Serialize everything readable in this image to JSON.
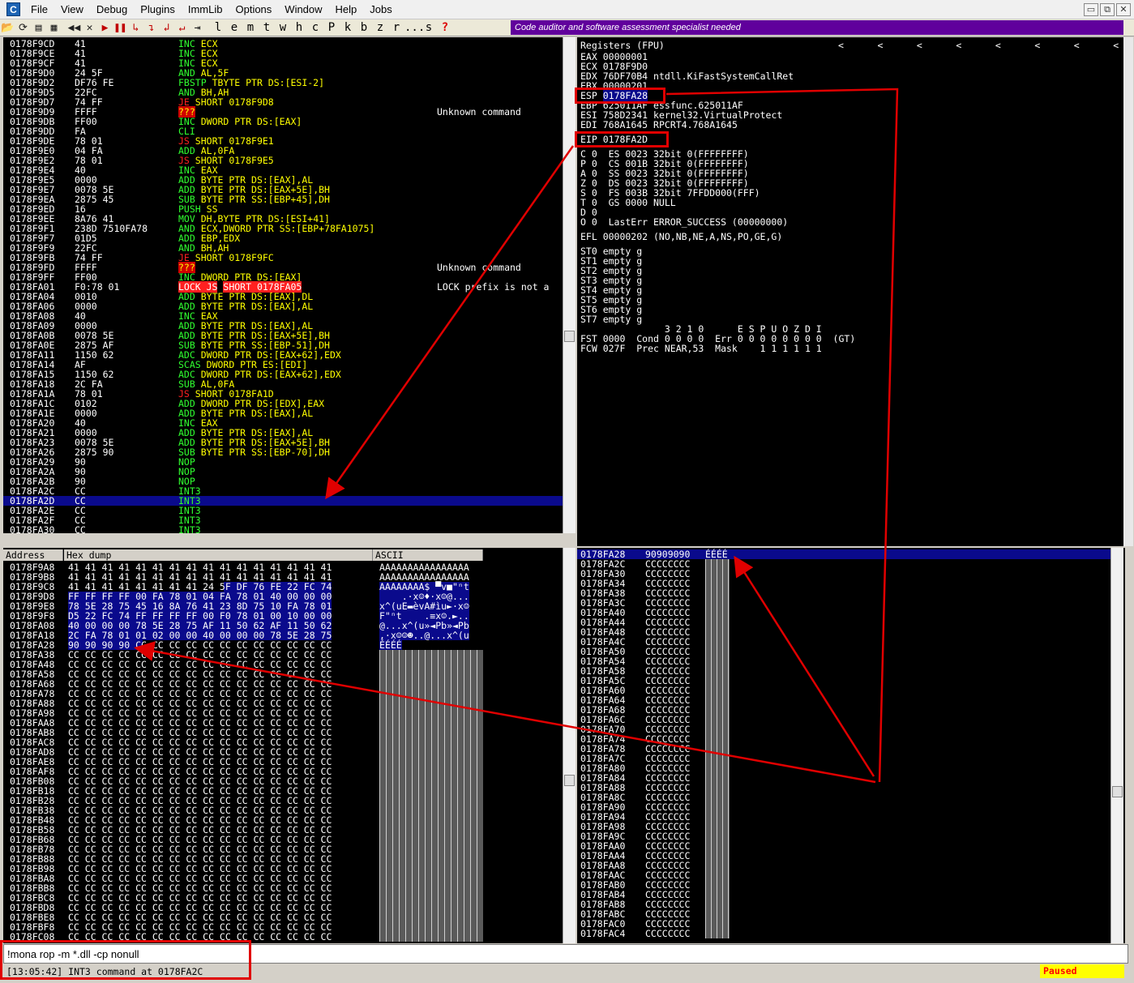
{
  "app": {
    "icon_letter": "C"
  },
  "menu": [
    "File",
    "View",
    "Debug",
    "Plugins",
    "ImmLib",
    "Options",
    "Window",
    "Help",
    "Jobs"
  ],
  "window_buttons": [
    "▭",
    "⧉",
    "✕"
  ],
  "toolbar": {
    "letters": [
      "l",
      "e",
      "m",
      "t",
      "w",
      "h",
      "c",
      "P",
      "k",
      "b",
      "z",
      "r",
      "...",
      "s"
    ],
    "help": "?",
    "banner": "Code auditor and software assessment specialist needed"
  },
  "cpu": {
    "rows": [
      {
        "addr": "0178F9CD",
        "hex": "41",
        "mn": "INC",
        "op": "ECX",
        "cm": ""
      },
      {
        "addr": "0178F9CE",
        "hex": "41",
        "mn": "INC",
        "op": "ECX",
        "cm": ""
      },
      {
        "addr": "0178F9CF",
        "hex": "41",
        "mn": "INC",
        "op": "ECX",
        "cm": ""
      },
      {
        "addr": "0178F9D0",
        "hex": "24 5F",
        "mn": "AND",
        "op": "AL,5F",
        "cm": ""
      },
      {
        "addr": "0178F9D2",
        "hex": "DF76 FE",
        "mn": "FBSTP",
        "op": "TBYTE PTR DS:[ESI-2]",
        "cm": ""
      },
      {
        "addr": "0178F9D5",
        "hex": "22FC",
        "mn": "AND",
        "op": "BH,AH",
        "cm": ""
      },
      {
        "addr": "0178F9D7",
        "hex": "74 FF",
        "mn": "JE",
        "op": "SHORT 0178F9D8",
        "cm": ""
      },
      {
        "addr": "0178F9D9",
        "hex": "FFFF",
        "mn": "???",
        "op": "",
        "cm": "Unknown command"
      },
      {
        "addr": "0178F9DB",
        "hex": "FF00",
        "mn": "INC",
        "op": "DWORD PTR DS:[EAX]",
        "cm": ""
      },
      {
        "addr": "0178F9DD",
        "hex": "FA",
        "mn": "CLI",
        "op": "",
        "cm": ""
      },
      {
        "addr": "0178F9DE",
        "hex": "78 01",
        "mn": "JS",
        "op": "SHORT 0178F9E1",
        "cm": ""
      },
      {
        "addr": "0178F9E0",
        "hex": "04 FA",
        "mn": "ADD",
        "op": "AL,0FA",
        "cm": ""
      },
      {
        "addr": "0178F9E2",
        "hex": "78 01",
        "mn": "JS",
        "op": "SHORT 0178F9E5",
        "cm": ""
      },
      {
        "addr": "0178F9E4",
        "hex": "40",
        "mn": "INC",
        "op": "EAX",
        "cm": ""
      },
      {
        "addr": "0178F9E5",
        "hex": "0000",
        "mn": "ADD",
        "op": "BYTE PTR DS:[EAX],AL",
        "cm": ""
      },
      {
        "addr": "0178F9E7",
        "hex": "0078 5E",
        "mn": "ADD",
        "op": "BYTE PTR DS:[EAX+5E],BH",
        "cm": ""
      },
      {
        "addr": "0178F9EA",
        "hex": "2875 45",
        "mn": "SUB",
        "op": "BYTE PTR SS:[EBP+45],DH",
        "cm": ""
      },
      {
        "addr": "0178F9ED",
        "hex": "16",
        "mn": "PUSH",
        "op": "SS",
        "cm": ""
      },
      {
        "addr": "0178F9EE",
        "hex": "8A76 41",
        "mn": "MOV",
        "op": "DH,BYTE PTR DS:[ESI+41]",
        "cm": ""
      },
      {
        "addr": "0178F9F1",
        "hex": "238D 7510FA78",
        "mn": "AND",
        "op": "ECX,DWORD PTR SS:[EBP+78FA1075]",
        "cm": ""
      },
      {
        "addr": "0178F9F7",
        "hex": "01D5",
        "mn": "ADD",
        "op": "EBP,EDX",
        "cm": ""
      },
      {
        "addr": "0178F9F9",
        "hex": "22FC",
        "mn": "AND",
        "op": "BH,AH",
        "cm": ""
      },
      {
        "addr": "0178F9FB",
        "hex": "74 FF",
        "mn": "JE",
        "op": "SHORT 0178F9FC",
        "cm": ""
      },
      {
        "addr": "0178F9FD",
        "hex": "FFFF",
        "mn": "???",
        "op": "",
        "cm": "Unknown command"
      },
      {
        "addr": "0178F9FF",
        "hex": "FF00",
        "mn": "INC",
        "op": "DWORD PTR DS:[EAX]",
        "cm": ""
      },
      {
        "addr": "0178FA01",
        "hex": "F0:78 01",
        "mn": "LOCK JS",
        "op": "SHORT 0178FA05",
        "cm": "LOCK prefix is not a"
      },
      {
        "addr": "0178FA04",
        "hex": "0010",
        "mn": "ADD",
        "op": "BYTE PTR DS:[EAX],DL",
        "cm": ""
      },
      {
        "addr": "0178FA06",
        "hex": "0000",
        "mn": "ADD",
        "op": "BYTE PTR DS:[EAX],AL",
        "cm": ""
      },
      {
        "addr": "0178FA08",
        "hex": "40",
        "mn": "INC",
        "op": "EAX",
        "cm": ""
      },
      {
        "addr": "0178FA09",
        "hex": "0000",
        "mn": "ADD",
        "op": "BYTE PTR DS:[EAX],AL",
        "cm": ""
      },
      {
        "addr": "0178FA0B",
        "hex": "0078 5E",
        "mn": "ADD",
        "op": "BYTE PTR DS:[EAX+5E],BH",
        "cm": ""
      },
      {
        "addr": "0178FA0E",
        "hex": "2875 AF",
        "mn": "SUB",
        "op": "BYTE PTR SS:[EBP-51],DH",
        "cm": ""
      },
      {
        "addr": "0178FA11",
        "hex": "1150 62",
        "mn": "ADC",
        "op": "DWORD PTR DS:[EAX+62],EDX",
        "cm": ""
      },
      {
        "addr": "0178FA14",
        "hex": "AF",
        "mn": "SCAS",
        "op": "DWORD PTR ES:[EDI]",
        "cm": ""
      },
      {
        "addr": "0178FA15",
        "hex": "1150 62",
        "mn": "ADC",
        "op": "DWORD PTR DS:[EAX+62],EDX",
        "cm": ""
      },
      {
        "addr": "0178FA18",
        "hex": "2C FA",
        "mn": "SUB",
        "op": "AL,0FA",
        "cm": ""
      },
      {
        "addr": "0178FA1A",
        "hex": "78 01",
        "mn": "JS",
        "op": "SHORT 0178FA1D",
        "cm": ""
      },
      {
        "addr": "0178FA1C",
        "hex": "0102",
        "mn": "ADD",
        "op": "DWORD PTR DS:[EDX],EAX",
        "cm": ""
      },
      {
        "addr": "0178FA1E",
        "hex": "0000",
        "mn": "ADD",
        "op": "BYTE PTR DS:[EAX],AL",
        "cm": ""
      },
      {
        "addr": "0178FA20",
        "hex": "40",
        "mn": "INC",
        "op": "EAX",
        "cm": ""
      },
      {
        "addr": "0178FA21",
        "hex": "0000",
        "mn": "ADD",
        "op": "BYTE PTR DS:[EAX],AL",
        "cm": ""
      },
      {
        "addr": "0178FA23",
        "hex": "0078 5E",
        "mn": "ADD",
        "op": "BYTE PTR DS:[EAX+5E],BH",
        "cm": ""
      },
      {
        "addr": "0178FA26",
        "hex": "2875 90",
        "mn": "SUB",
        "op": "BYTE PTR SS:[EBP-70],DH",
        "cm": ""
      },
      {
        "addr": "0178FA29",
        "hex": "90",
        "mn": "NOP",
        "op": "",
        "cm": ""
      },
      {
        "addr": "0178FA2A",
        "hex": "90",
        "mn": "NOP",
        "op": "",
        "cm": ""
      },
      {
        "addr": "0178FA2B",
        "hex": "90",
        "mn": "NOP",
        "op": "",
        "cm": ""
      },
      {
        "addr": "0178FA2C",
        "hex": "CC",
        "mn": "INT3",
        "op": "",
        "cm": ""
      },
      {
        "addr": "0178FA2D",
        "hex": "CC",
        "mn": "INT3",
        "op": "",
        "cm": ""
      },
      {
        "addr": "0178FA2E",
        "hex": "CC",
        "mn": "INT3",
        "op": "",
        "cm": ""
      },
      {
        "addr": "0178FA2F",
        "hex": "CC",
        "mn": "INT3",
        "op": "",
        "cm": ""
      },
      {
        "addr": "0178FA30",
        "hex": "CC",
        "mn": "INT3",
        "op": "",
        "cm": ""
      }
    ]
  },
  "registers": {
    "title": "Registers (FPU)",
    "arrows": "<      <      <      <      <      <      <      <",
    "gp": [
      {
        "name": "EAX",
        "val": "00000001",
        "info": ""
      },
      {
        "name": "ECX",
        "val": "0178F9D0",
        "info": ""
      },
      {
        "name": "EDX",
        "val": "76DF70B4",
        "info": "ntdll.KiFastSystemCallRet"
      },
      {
        "name": "EBX",
        "val": "00000201",
        "info": ""
      },
      {
        "name": "ESP",
        "val": "0178FA28",
        "info": ""
      },
      {
        "name": "EBP",
        "val": "625011AF",
        "info": "essfunc.625011AF"
      },
      {
        "name": "ESI",
        "val": "758D2341",
        "info": "kernel32.VirtualProtect"
      },
      {
        "name": "EDI",
        "val": "768A1645",
        "info": "RPCRT4.768A1645"
      }
    ],
    "eip": {
      "name": "EIP",
      "val": "0178FA2D"
    },
    "flags": [
      "C 0  ES 0023 32bit 0(FFFFFFFF)",
      "P 0  CS 001B 32bit 0(FFFFFFFF)",
      "A 0  SS 0023 32bit 0(FFFFFFFF)",
      "Z 0  DS 0023 32bit 0(FFFFFFFF)",
      "S 0  FS 003B 32bit 7FFDD000(FFF)",
      "T 0  GS 0000 NULL",
      "D 0",
      "O 0  LastErr ERROR_SUCCESS (00000000)"
    ],
    "efl": "EFL 00000202 (NO,NB,NE,A,NS,PO,GE,G)",
    "fpu": [
      "ST0 empty g",
      "ST1 empty g",
      "ST2 empty g",
      "ST3 empty g",
      "ST4 empty g",
      "ST5 empty g",
      "ST6 empty g",
      "ST7 empty g"
    ],
    "fpu_hdr": "               3 2 1 0      E S P U O Z D I",
    "fst": "FST 0000  Cond 0 0 0 0  Err 0 0 0 0 0 0 0 0  (GT)",
    "fcw": "FCW 027F  Prec NEAR,53  Mask    1 1 1 1 1 1"
  },
  "dump": {
    "headers": [
      "Address",
      "Hex dump",
      "ASCII"
    ],
    "rows": [
      {
        "addr": "0178F9A8",
        "hex": "41 41 41 41 41 41 41 41 41 41 41 41 41 41 41 41",
        "asc": "AAAAAAAAAAAAAAAA",
        "hs": -1
      },
      {
        "addr": "0178F9B8",
        "hex": "41 41 41 41 41 41 41 41 41 41 41 41 41 41 41 41",
        "asc": "AAAAAAAAAAAAAAAA",
        "hs": -1
      },
      {
        "addr": "0178F9C8",
        "hex": "41 41 41 41 41 41 41 41 24 5F DF 76 FE 22 FC 74",
        "asc": "AAAAAAAA$_▀v■\"ⁿt",
        "hs": 8
      },
      {
        "addr": "0178F9D8",
        "hex": "FF FF FF FF 00 FA 78 01 04 FA 78 01 40 00 00 00",
        "asc": "    .·x☺♦·x☺@...",
        "hs": 0
      },
      {
        "addr": "0178F9E8",
        "hex": "78 5E 28 75 45 16 8A 76 41 23 8D 75 10 FA 78 01",
        "asc": "x^(uE▬èvA#ìu►·x☺",
        "hs": 0
      },
      {
        "addr": "0178F9F8",
        "hex": "D5 22 FC 74 FF FF FF FF 00 F0 78 01 00 10 00 00",
        "asc": "F\"ⁿt    .≡x☺.►..",
        "hs": 0
      },
      {
        "addr": "0178FA08",
        "hex": "40 00 00 00 78 5E 28 75 AF 11 50 62 AF 11 50 62",
        "asc": "@...x^(u»◄Pb»◄Pb",
        "hs": 0
      },
      {
        "addr": "0178FA18",
        "hex": "2C FA 78 01 01 02 00 00 40 00 00 00 78 5E 28 75",
        "asc": ",·x☺☺☻..@...x^(u",
        "hs": 0
      },
      {
        "addr": "0178FA28",
        "hex": "90 90 90 90 CC CC CC CC CC CC CC CC CC CC CC CC",
        "asc": "ÉÉÉÉ",
        "hs": 0
      },
      {
        "addr": "0178FA38",
        "hex": "CC CC CC CC CC CC CC CC CC CC CC CC CC CC CC CC",
        "asc": "",
        "hs": -1
      },
      {
        "addr": "0178FA48",
        "hex": "CC CC CC CC CC CC CC CC CC CC CC CC CC CC CC CC",
        "asc": "",
        "hs": -1
      },
      {
        "addr": "0178FA58",
        "hex": "CC CC CC CC CC CC CC CC CC CC CC CC CC CC CC CC",
        "asc": "",
        "hs": -1
      },
      {
        "addr": "0178FA68",
        "hex": "CC CC CC CC CC CC CC CC CC CC CC CC CC CC CC CC",
        "asc": "",
        "hs": -1
      },
      {
        "addr": "0178FA78",
        "hex": "CC CC CC CC CC CC CC CC CC CC CC CC CC CC CC CC",
        "asc": "",
        "hs": -1
      },
      {
        "addr": "0178FA88",
        "hex": "CC CC CC CC CC CC CC CC CC CC CC CC CC CC CC CC",
        "asc": "",
        "hs": -1
      },
      {
        "addr": "0178FA98",
        "hex": "CC CC CC CC CC CC CC CC CC CC CC CC CC CC CC CC",
        "asc": "",
        "hs": -1
      },
      {
        "addr": "0178FAA8",
        "hex": "CC CC CC CC CC CC CC CC CC CC CC CC CC CC CC CC",
        "asc": "",
        "hs": -1
      },
      {
        "addr": "0178FAB8",
        "hex": "CC CC CC CC CC CC CC CC CC CC CC CC CC CC CC CC",
        "asc": "",
        "hs": -1
      },
      {
        "addr": "0178FAC8",
        "hex": "CC CC CC CC CC CC CC CC CC CC CC CC CC CC CC CC",
        "asc": "",
        "hs": -1
      },
      {
        "addr": "0178FAD8",
        "hex": "CC CC CC CC CC CC CC CC CC CC CC CC CC CC CC CC",
        "asc": "",
        "hs": -1
      },
      {
        "addr": "0178FAE8",
        "hex": "CC CC CC CC CC CC CC CC CC CC CC CC CC CC CC CC",
        "asc": "",
        "hs": -1
      },
      {
        "addr": "0178FAF8",
        "hex": "CC CC CC CC CC CC CC CC CC CC CC CC CC CC CC CC",
        "asc": "",
        "hs": -1
      },
      {
        "addr": "0178FB08",
        "hex": "CC CC CC CC CC CC CC CC CC CC CC CC CC CC CC CC",
        "asc": "",
        "hs": -1
      },
      {
        "addr": "0178FB18",
        "hex": "CC CC CC CC CC CC CC CC CC CC CC CC CC CC CC CC",
        "asc": "",
        "hs": -1
      },
      {
        "addr": "0178FB28",
        "hex": "CC CC CC CC CC CC CC CC CC CC CC CC CC CC CC CC",
        "asc": "",
        "hs": -1
      },
      {
        "addr": "0178FB38",
        "hex": "CC CC CC CC CC CC CC CC CC CC CC CC CC CC CC CC",
        "asc": "",
        "hs": -1
      },
      {
        "addr": "0178FB48",
        "hex": "CC CC CC CC CC CC CC CC CC CC CC CC CC CC CC CC",
        "asc": "",
        "hs": -1
      },
      {
        "addr": "0178FB58",
        "hex": "CC CC CC CC CC CC CC CC CC CC CC CC CC CC CC CC",
        "asc": "",
        "hs": -1
      },
      {
        "addr": "0178FB68",
        "hex": "CC CC CC CC CC CC CC CC CC CC CC CC CC CC CC CC",
        "asc": "",
        "hs": -1
      },
      {
        "addr": "0178FB78",
        "hex": "CC CC CC CC CC CC CC CC CC CC CC CC CC CC CC CC",
        "asc": "",
        "hs": -1
      },
      {
        "addr": "0178FB88",
        "hex": "CC CC CC CC CC CC CC CC CC CC CC CC CC CC CC CC",
        "asc": "",
        "hs": -1
      },
      {
        "addr": "0178FB98",
        "hex": "CC CC CC CC CC CC CC CC CC CC CC CC CC CC CC CC",
        "asc": "",
        "hs": -1
      },
      {
        "addr": "0178FBA8",
        "hex": "CC CC CC CC CC CC CC CC CC CC CC CC CC CC CC CC",
        "asc": "",
        "hs": -1
      },
      {
        "addr": "0178FBB8",
        "hex": "CC CC CC CC CC CC CC CC CC CC CC CC CC CC CC CC",
        "asc": "",
        "hs": -1
      },
      {
        "addr": "0178FBC8",
        "hex": "CC CC CC CC CC CC CC CC CC CC CC CC CC CC CC CC",
        "asc": "",
        "hs": -1
      },
      {
        "addr": "0178FBD8",
        "hex": "CC CC CC CC CC CC CC CC CC CC CC CC CC CC CC CC",
        "asc": "",
        "hs": -1
      },
      {
        "addr": "0178FBE8",
        "hex": "CC CC CC CC CC CC CC CC CC CC CC CC CC CC CC CC",
        "asc": "",
        "hs": -1
      },
      {
        "addr": "0178FBF8",
        "hex": "CC CC CC CC CC CC CC CC CC CC CC CC CC CC CC CC",
        "asc": "",
        "hs": -1
      },
      {
        "addr": "0178FC08",
        "hex": "CC CC CC CC CC CC CC CC CC CC CC CC CC CC CC CC",
        "asc": "",
        "hs": -1
      }
    ]
  },
  "stack": {
    "rows": [
      {
        "addr": "0178FA28",
        "val": "90909090",
        "asc": "ÉÉÉÉ"
      },
      {
        "addr": "0178FA2C",
        "val": "CCCCCCCC",
        "asc": ""
      },
      {
        "addr": "0178FA30",
        "val": "CCCCCCCC",
        "asc": ""
      },
      {
        "addr": "0178FA34",
        "val": "CCCCCCCC",
        "asc": ""
      },
      {
        "addr": "0178FA38",
        "val": "CCCCCCCC",
        "asc": ""
      },
      {
        "addr": "0178FA3C",
        "val": "CCCCCCCC",
        "asc": ""
      },
      {
        "addr": "0178FA40",
        "val": "CCCCCCCC",
        "asc": ""
      },
      {
        "addr": "0178FA44",
        "val": "CCCCCCCC",
        "asc": ""
      },
      {
        "addr": "0178FA48",
        "val": "CCCCCCCC",
        "asc": ""
      },
      {
        "addr": "0178FA4C",
        "val": "CCCCCCCC",
        "asc": ""
      },
      {
        "addr": "0178FA50",
        "val": "CCCCCCCC",
        "asc": ""
      },
      {
        "addr": "0178FA54",
        "val": "CCCCCCCC",
        "asc": ""
      },
      {
        "addr": "0178FA58",
        "val": "CCCCCCCC",
        "asc": ""
      },
      {
        "addr": "0178FA5C",
        "val": "CCCCCCCC",
        "asc": ""
      },
      {
        "addr": "0178FA60",
        "val": "CCCCCCCC",
        "asc": ""
      },
      {
        "addr": "0178FA64",
        "val": "CCCCCCCC",
        "asc": ""
      },
      {
        "addr": "0178FA68",
        "val": "CCCCCCCC",
        "asc": ""
      },
      {
        "addr": "0178FA6C",
        "val": "CCCCCCCC",
        "asc": ""
      },
      {
        "addr": "0178FA70",
        "val": "CCCCCCCC",
        "asc": ""
      },
      {
        "addr": "0178FA74",
        "val": "CCCCCCCC",
        "asc": ""
      },
      {
        "addr": "0178FA78",
        "val": "CCCCCCCC",
        "asc": ""
      },
      {
        "addr": "0178FA7C",
        "val": "CCCCCCCC",
        "asc": ""
      },
      {
        "addr": "0178FA80",
        "val": "CCCCCCCC",
        "asc": ""
      },
      {
        "addr": "0178FA84",
        "val": "CCCCCCCC",
        "asc": ""
      },
      {
        "addr": "0178FA88",
        "val": "CCCCCCCC",
        "asc": ""
      },
      {
        "addr": "0178FA8C",
        "val": "CCCCCCCC",
        "asc": ""
      },
      {
        "addr": "0178FA90",
        "val": "CCCCCCCC",
        "asc": ""
      },
      {
        "addr": "0178FA94",
        "val": "CCCCCCCC",
        "asc": ""
      },
      {
        "addr": "0178FA98",
        "val": "CCCCCCCC",
        "asc": ""
      },
      {
        "addr": "0178FA9C",
        "val": "CCCCCCCC",
        "asc": ""
      },
      {
        "addr": "0178FAA0",
        "val": "CCCCCCCC",
        "asc": ""
      },
      {
        "addr": "0178FAA4",
        "val": "CCCCCCCC",
        "asc": ""
      },
      {
        "addr": "0178FAA8",
        "val": "CCCCCCCC",
        "asc": ""
      },
      {
        "addr": "0178FAAC",
        "val": "CCCCCCCC",
        "asc": ""
      },
      {
        "addr": "0178FAB0",
        "val": "CCCCCCCC",
        "asc": ""
      },
      {
        "addr": "0178FAB4",
        "val": "CCCCCCCC",
        "asc": ""
      },
      {
        "addr": "0178FAB8",
        "val": "CCCCCCCC",
        "asc": ""
      },
      {
        "addr": "0178FABC",
        "val": "CCCCCCCC",
        "asc": ""
      },
      {
        "addr": "0178FAC0",
        "val": "CCCCCCCC",
        "asc": ""
      },
      {
        "addr": "0178FAC4",
        "val": "CCCCCCCC",
        "asc": ""
      }
    ]
  },
  "command": {
    "value": "!mona rop -m *.dll -cp nonull"
  },
  "status": {
    "message": "[13:05:42] INT3 command at 0178FA2C",
    "state": "Paused"
  },
  "colors": {
    "annotation": "#e00000",
    "selection": "#0a0a8c",
    "banner": "#60009c"
  }
}
